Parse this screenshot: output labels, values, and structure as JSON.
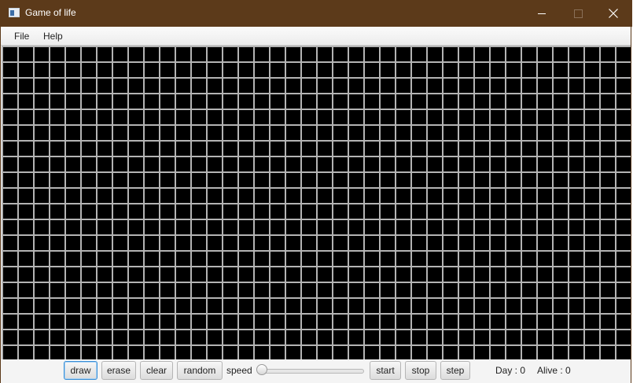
{
  "window": {
    "title": "Game of life",
    "icons": {
      "app": "app-window-icon",
      "minimize": "minimize-icon",
      "maximize": "maximize-icon",
      "close": "close-icon"
    }
  },
  "menu": {
    "file": "File",
    "help": "Help"
  },
  "grid": {
    "columns": 40,
    "rows": 20,
    "cell_color": "#000000",
    "line_color": "#b4b4b4"
  },
  "toolbar": {
    "draw": "draw",
    "erase": "erase",
    "clear": "clear",
    "random": "random",
    "speed_label": "speed",
    "speed_value": 0,
    "start": "start",
    "stop": "stop",
    "step": "step"
  },
  "status": {
    "day": "Day : 0",
    "alive": "Alive : 0"
  },
  "colors": {
    "titlebar": "#5c3a1a",
    "focus": "#3a8fd6"
  }
}
